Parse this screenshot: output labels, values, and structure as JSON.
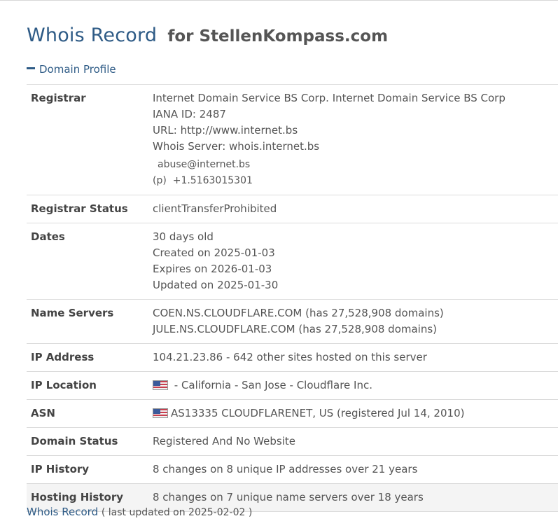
{
  "header": {
    "title_main": "Whois Record",
    "title_for": "for StellenKompass.com"
  },
  "section": {
    "label": "Domain Profile"
  },
  "profile": {
    "registrar_label": "Registrar",
    "registrar_name": "Internet Domain Service BS Corp. Internet Domain Service BS Corp",
    "iana_id": "IANA ID: 2487",
    "url": "URL: http://www.internet.bs",
    "whois_server": "Whois Server: whois.internet.bs",
    "abuse_email": "abuse@internet.bs",
    "phone_prefix": "(p)",
    "phone": "+1.5163015301",
    "registrar_status_label": "Registrar Status",
    "registrar_status": "clientTransferProhibited",
    "dates_label": "Dates",
    "age": "30 days old",
    "created": "Created on 2025-01-03",
    "expires": "Expires on 2026-01-03",
    "updated": "Updated on 2025-01-30",
    "name_servers_label": "Name Servers",
    "ns1": "COEN.NS.CLOUDFLARE.COM (has 27,528,908 domains)",
    "ns2": "JULE.NS.CLOUDFLARE.COM (has 27,528,908 domains)",
    "ip_label": "IP Address",
    "ip": "104.21.23.86 - 642 other sites hosted on this server",
    "ip_location_label": "IP Location",
    "ip_location": " - California - San Jose - Cloudflare Inc.",
    "asn_label": "ASN",
    "asn": "AS13335 CLOUDFLARENET, US (registered Jul 14, 2010)",
    "domain_status_label": "Domain Status",
    "domain_status": "Registered And No Website",
    "ip_history_label": "IP History",
    "ip_history": "8 changes on 8 unique IP addresses over 21 years",
    "hosting_history_label": "Hosting History",
    "hosting_history": "8 changes on 7 unique name servers over 18 years"
  },
  "footer": {
    "link": "Whois Record",
    "updated": "( last updated on 2025-02-02 )"
  },
  "colors": {
    "heading_blue": "#2e5b86",
    "row_border": "#dcdcdc",
    "highlight_row": "#f4f4f4"
  },
  "icons": {
    "flag": "us-flag-icon"
  }
}
